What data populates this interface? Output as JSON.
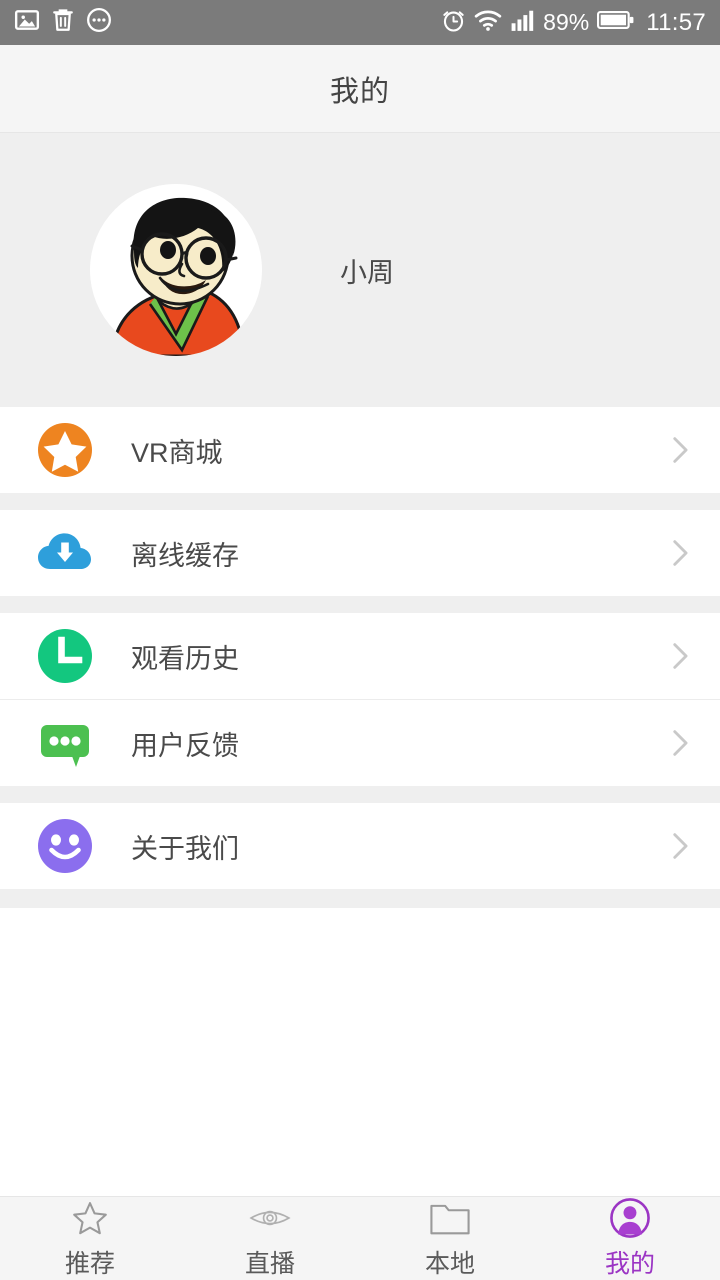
{
  "statusbar": {
    "left_icons": [
      "image-icon",
      "trash-icon",
      "more-circle-icon"
    ],
    "right_icons": [
      "alarm-icon",
      "wifi-icon",
      "signal-icon",
      "battery-icon"
    ],
    "battery_percent": "89%",
    "time": "11:57",
    "background": "#7b7b7b"
  },
  "header": {
    "title": "我的"
  },
  "profile": {
    "avatar_name": "user-avatar-cartoon",
    "username": "小周"
  },
  "menu": {
    "groups": [
      {
        "items": [
          {
            "icon": "star-circle-icon",
            "label": "VR商城",
            "color": "#ee8420",
            "chevron": "chevron-right-icon"
          }
        ]
      },
      {
        "items": [
          {
            "icon": "cloud-download-icon",
            "label": "离线缓存",
            "color": "#2e9fdb",
            "chevron": "chevron-right-icon"
          }
        ]
      },
      {
        "items": [
          {
            "icon": "clock-circle-icon",
            "label": "观看历史",
            "color": "#13c77f",
            "chevron": "chevron-right-icon"
          },
          {
            "icon": "speech-bubble-icon",
            "label": "用户反馈",
            "color": "#4cc050",
            "chevron": "chevron-right-icon"
          }
        ]
      },
      {
        "items": [
          {
            "icon": "smiley-face-icon",
            "label": "关于我们",
            "color": "#8b6eee",
            "chevron": "chevron-right-icon"
          }
        ]
      }
    ]
  },
  "tabbar": {
    "active_color": "#9b35c4",
    "inactive_color": "#5a5a5a",
    "tabs": [
      {
        "icon": "star-outline-icon",
        "label": "推荐",
        "active": false
      },
      {
        "icon": "eye-icon",
        "label": "直播",
        "active": false
      },
      {
        "icon": "folder-icon",
        "label": "本地",
        "active": false
      },
      {
        "icon": "person-circle-icon",
        "label": "我的",
        "active": true
      }
    ]
  }
}
